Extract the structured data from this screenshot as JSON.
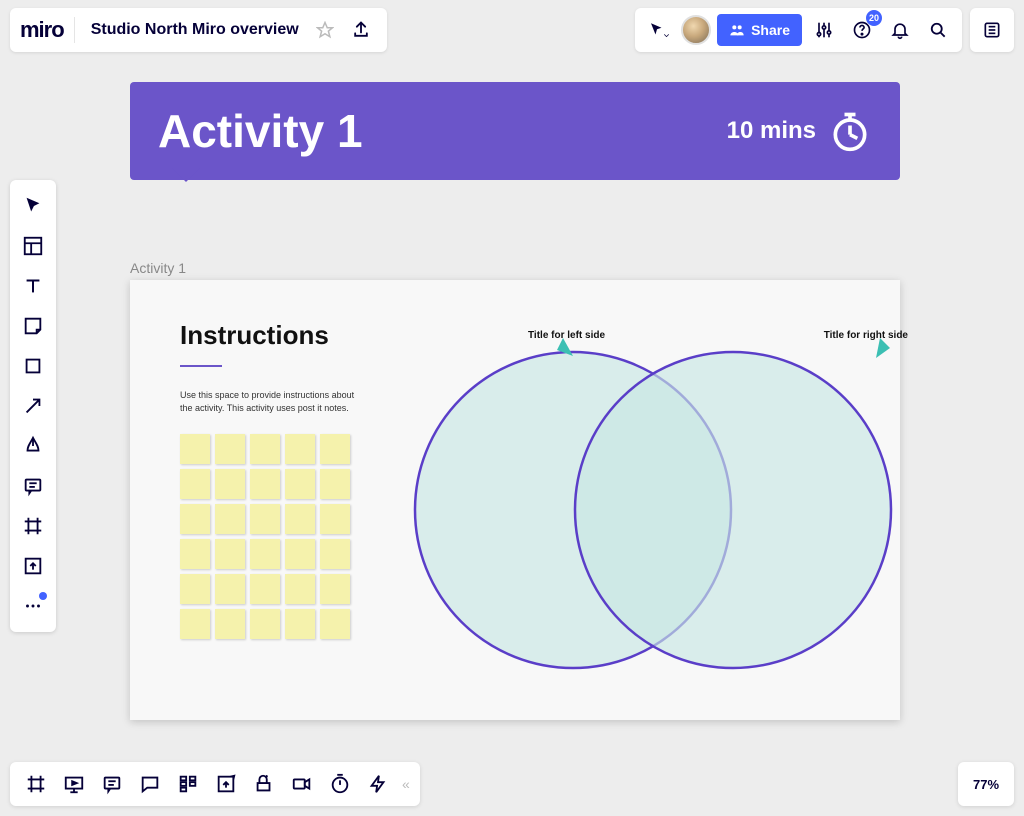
{
  "header": {
    "logo_text": "miro",
    "board_title": "Studio North Miro overview",
    "share_label": "Share",
    "notification_count": "20"
  },
  "canvas": {
    "activity_header_title": "Activity 1",
    "activity_header_time": "10 mins",
    "frame_label": "Activity 1",
    "instructions_title": "Instructions",
    "instructions_body": "Use this space to provide instructions about the activity. This activity uses post it notes.",
    "venn_left_label": "Title for left side",
    "venn_right_label": "Title for right side"
  },
  "footer": {
    "zoom_level": "77%"
  },
  "colors": {
    "brand_purple": "#6b55c9",
    "action_blue": "#4262ff",
    "sticky_yellow": "#f5f2ac"
  },
  "icons": {
    "star": "star-icon",
    "export": "export-icon",
    "cursor_tracking": "cursor-tracking-icon",
    "share": "share-people-icon",
    "settings": "settings-sliders-icon",
    "help": "help-icon",
    "bell": "notification-bell-icon",
    "search": "search-icon",
    "panel": "panel-layout-icon",
    "select": "select-tool-icon",
    "templates": "templates-tool-icon",
    "text": "text-tool-icon",
    "sticky": "sticky-note-tool-icon",
    "shape": "shape-tool-icon",
    "arrow": "arrow-tool-icon",
    "pen": "pen-tool-icon",
    "comment": "comment-tool-icon",
    "frame": "frame-tool-icon",
    "upload": "upload-tool-icon",
    "more": "more-tools-icon",
    "timer": "stopwatch-icon"
  }
}
